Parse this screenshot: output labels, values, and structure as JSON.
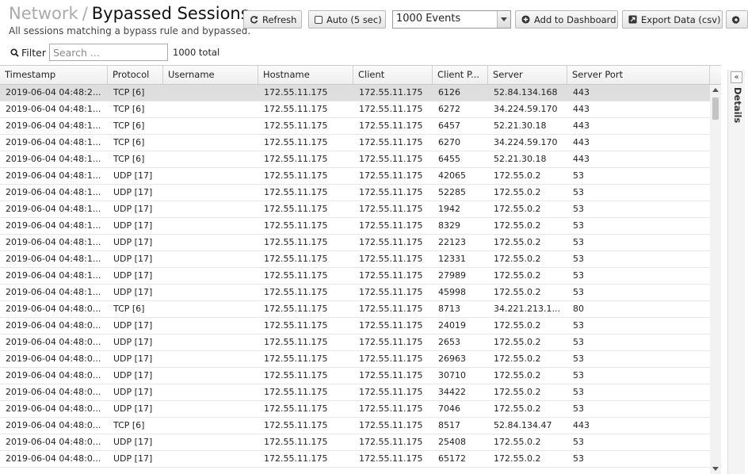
{
  "breadcrumb": "Network",
  "separator": "/",
  "page_title": "Bypassed Sessions",
  "subtitle": "All sessions matching a bypass rule and bypassed.",
  "toolbar": {
    "refresh_label": "Refresh",
    "auto_label": "Auto (5 sec)",
    "events_selected": "1000 Events",
    "add_dashboard_label": "Add to Dashboard",
    "export_label": "Export Data (csv)"
  },
  "filter": {
    "label": "Filter",
    "placeholder": "Search ...",
    "total": "1000 total"
  },
  "columns": [
    "Timestamp",
    "Protocol",
    "Username",
    "Hostname",
    "Client",
    "Client P...",
    "Server",
    "Server Port"
  ],
  "rows": [
    [
      "2019-06-04 04:48:2...",
      "TCP [6]",
      "",
      "172.55.11.175",
      "172.55.11.175",
      "6126",
      "52.84.134.168",
      "443"
    ],
    [
      "2019-06-04 04:48:1...",
      "TCP [6]",
      "",
      "172.55.11.175",
      "172.55.11.175",
      "6272",
      "34.224.59.170",
      "443"
    ],
    [
      "2019-06-04 04:48:1...",
      "TCP [6]",
      "",
      "172.55.11.175",
      "172.55.11.175",
      "6457",
      "52.21.30.18",
      "443"
    ],
    [
      "2019-06-04 04:48:1...",
      "TCP [6]",
      "",
      "172.55.11.175",
      "172.55.11.175",
      "6270",
      "34.224.59.170",
      "443"
    ],
    [
      "2019-06-04 04:48:1...",
      "TCP [6]",
      "",
      "172.55.11.175",
      "172.55.11.175",
      "6455",
      "52.21.30.18",
      "443"
    ],
    [
      "2019-06-04 04:48:1...",
      "UDP [17]",
      "",
      "172.55.11.175",
      "172.55.11.175",
      "42065",
      "172.55.0.2",
      "53"
    ],
    [
      "2019-06-04 04:48:1...",
      "UDP [17]",
      "",
      "172.55.11.175",
      "172.55.11.175",
      "52285",
      "172.55.0.2",
      "53"
    ],
    [
      "2019-06-04 04:48:1...",
      "UDP [17]",
      "",
      "172.55.11.175",
      "172.55.11.175",
      "1942",
      "172.55.0.2",
      "53"
    ],
    [
      "2019-06-04 04:48:1...",
      "UDP [17]",
      "",
      "172.55.11.175",
      "172.55.11.175",
      "8329",
      "172.55.0.2",
      "53"
    ],
    [
      "2019-06-04 04:48:1...",
      "UDP [17]",
      "",
      "172.55.11.175",
      "172.55.11.175",
      "22123",
      "172.55.0.2",
      "53"
    ],
    [
      "2019-06-04 04:48:1...",
      "UDP [17]",
      "",
      "172.55.11.175",
      "172.55.11.175",
      "12331",
      "172.55.0.2",
      "53"
    ],
    [
      "2019-06-04 04:48:1...",
      "UDP [17]",
      "",
      "172.55.11.175",
      "172.55.11.175",
      "27989",
      "172.55.0.2",
      "53"
    ],
    [
      "2019-06-04 04:48:1...",
      "UDP [17]",
      "",
      "172.55.11.175",
      "172.55.11.175",
      "45998",
      "172.55.0.2",
      "53"
    ],
    [
      "2019-06-04 04:48:0...",
      "TCP [6]",
      "",
      "172.55.11.175",
      "172.55.11.175",
      "8713",
      "34.221.213.1...",
      "80"
    ],
    [
      "2019-06-04 04:48:0...",
      "UDP [17]",
      "",
      "172.55.11.175",
      "172.55.11.175",
      "24019",
      "172.55.0.2",
      "53"
    ],
    [
      "2019-06-04 04:48:0...",
      "UDP [17]",
      "",
      "172.55.11.175",
      "172.55.11.175",
      "2653",
      "172.55.0.2",
      "53"
    ],
    [
      "2019-06-04 04:48:0...",
      "UDP [17]",
      "",
      "172.55.11.175",
      "172.55.11.175",
      "26963",
      "172.55.0.2",
      "53"
    ],
    [
      "2019-06-04 04:48:0...",
      "UDP [17]",
      "",
      "172.55.11.175",
      "172.55.11.175",
      "30710",
      "172.55.0.2",
      "53"
    ],
    [
      "2019-06-04 04:48:0...",
      "UDP [17]",
      "",
      "172.55.11.175",
      "172.55.11.175",
      "34422",
      "172.55.0.2",
      "53"
    ],
    [
      "2019-06-04 04:48:0...",
      "UDP [17]",
      "",
      "172.55.11.175",
      "172.55.11.175",
      "7046",
      "172.55.0.2",
      "53"
    ],
    [
      "2019-06-04 04:48:0...",
      "TCP [6]",
      "",
      "172.55.11.175",
      "172.55.11.175",
      "8517",
      "52.84.134.47",
      "443"
    ],
    [
      "2019-06-04 04:48:0...",
      "UDP [17]",
      "",
      "172.55.11.175",
      "172.55.11.175",
      "25408",
      "172.55.0.2",
      "53"
    ],
    [
      "2019-06-04 04:48:0...",
      "UDP [17]",
      "",
      "172.55.11.175",
      "172.55.11.175",
      "65172",
      "172.55.0.2",
      "53"
    ]
  ],
  "details_label": "Details",
  "details_collapse_glyph": "«",
  "colors": {
    "selected_row": "#dedede",
    "header_bg": "#efefef",
    "muted_text": "#aaaaaa"
  },
  "icons": [
    "refresh-icon",
    "checkbox-icon",
    "dropdown-arrow-icon",
    "plus-circle-icon",
    "export-icon",
    "gear-icon",
    "search-icon"
  ]
}
